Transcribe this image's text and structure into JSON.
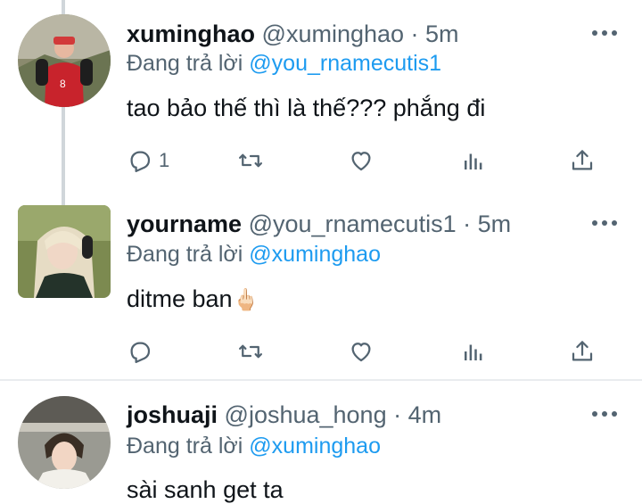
{
  "tweets": [
    {
      "name": "xuminghao",
      "handle": "@xuminghao",
      "time": "· 5m",
      "reply_prefix": "Đang trả lời",
      "reply_to": "@you_rnamecutis1",
      "text": "tao bảo thế thì là thế??? phắng đi",
      "reply_count": "1"
    },
    {
      "name": "yourname",
      "handle": "@you_rnamecutis1",
      "time": "· 5m",
      "reply_prefix": "Đang trả lời",
      "reply_to": "@xuminghao",
      "text": "ditme ban",
      "emoji": "🖕🏻",
      "reply_count": ""
    },
    {
      "name": "joshuaji",
      "handle": "@joshua_hong",
      "time": "· 4m",
      "reply_prefix": "Đang trả lời",
      "reply_to": "@xuminghao",
      "text": "sài sanh get ta"
    }
  ],
  "colors": {
    "link": "#1d9bf0",
    "muted": "#536471",
    "text": "#0f1419",
    "thread_line": "#d0d6da"
  },
  "icons": [
    "reply-icon",
    "retweet-icon",
    "like-icon",
    "views-icon",
    "share-icon",
    "more-icon"
  ]
}
